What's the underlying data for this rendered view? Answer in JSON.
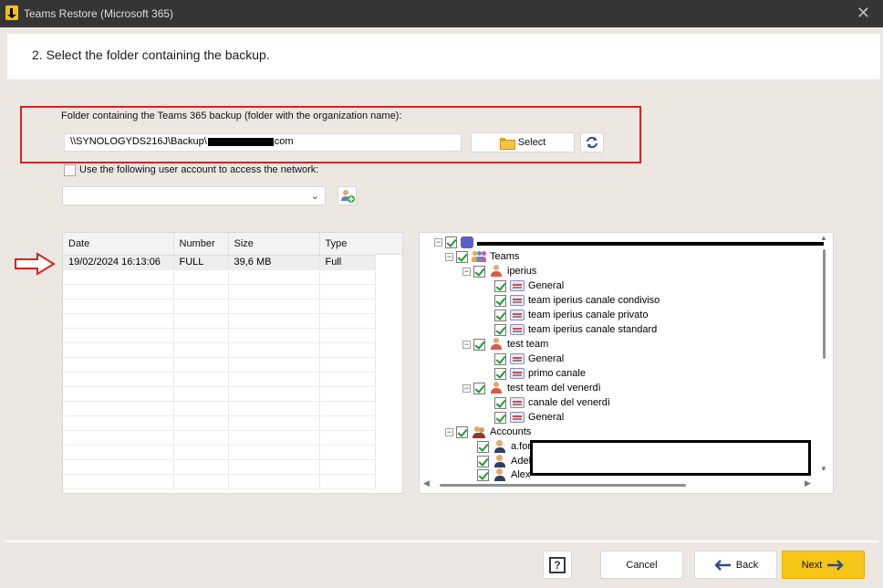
{
  "window": {
    "title": "Teams Restore (Microsoft 365)"
  },
  "step": {
    "title": "2. Select the folder containing the backup."
  },
  "folder": {
    "label": "Folder containing the Teams 365 backup (folder with the organization name):",
    "path_prefix": "\\\\SYNOLOGYDS216J\\Backup\\",
    "path_suffix": "com",
    "select_label": "Select"
  },
  "network": {
    "checkbox_label": "Use the following user account to access the network:",
    "checked": false,
    "account_value": ""
  },
  "backups": {
    "columns": [
      "Date",
      "Number",
      "Size",
      "Type"
    ],
    "rows": [
      {
        "date": "19/02/2024 16:13:06",
        "number": "FULL",
        "size": "39,6 MB",
        "type": "Full"
      }
    ]
  },
  "tree": {
    "teams_label": "Teams",
    "team1": {
      "name": "iperius",
      "channels": [
        "General",
        "team iperius canale condiviso",
        "team iperius canale privato",
        "team iperius canale standard"
      ]
    },
    "team2": {
      "name": "test team",
      "channels": [
        "General",
        "primo canale"
      ]
    },
    "team3": {
      "name": "test team del venerdì",
      "channels": [
        "canale del venerdì",
        "General"
      ]
    },
    "accounts_label": "Accounts",
    "accounts": [
      "a.for",
      "Adele",
      "Alex"
    ]
  },
  "footer": {
    "help_label": "?",
    "cancel_label": "Cancel",
    "back_label": "Back",
    "next_label": "Next"
  },
  "colors": {
    "next_button": "#f5c518",
    "highlight": "#d9231f",
    "check": "#1e9a2f"
  }
}
